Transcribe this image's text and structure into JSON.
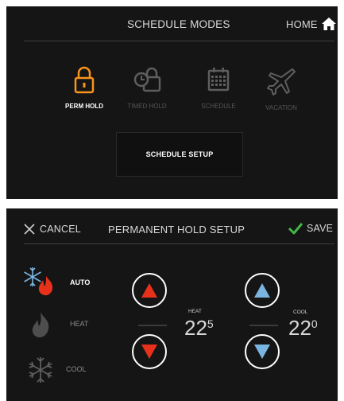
{
  "schedule_modes": {
    "title": "SCHEDULE MODES",
    "home_label": "HOME",
    "modes": [
      {
        "label": "PERM HOLD",
        "icon": "padlock-icon",
        "active": true
      },
      {
        "label": "TIMED HOLD",
        "icon": "timed-lock-icon",
        "active": false
      },
      {
        "label": "SCHEDULE",
        "icon": "calendar-icon",
        "active": false
      },
      {
        "label": "VACATION",
        "icon": "airplane-icon",
        "active": false
      }
    ],
    "setup_button": "SCHEDULE SETUP"
  },
  "hold_setup": {
    "cancel_label": "CANCEL",
    "title": "PERMANENT HOLD SETUP",
    "save_label": "SAVE",
    "modes": [
      {
        "label": "AUTO",
        "icon": "auto-mode-icon",
        "active": true
      },
      {
        "label": "HEAT",
        "icon": "flame-icon",
        "active": false
      },
      {
        "label": "COOL",
        "icon": "snowflake-icon",
        "active": false
      }
    ],
    "heat": {
      "label": "HEAT",
      "value": "22",
      "decimal": "5"
    },
    "cool": {
      "label": "COOL",
      "value": "22",
      "decimal": "0"
    }
  },
  "colors": {
    "background": "#151515",
    "accent_orange": "#f7941d",
    "heat_red": "#e8311b",
    "cool_blue": "#7ab4e0",
    "save_green": "#43b649",
    "inactive_gray": "#5e5e5e"
  }
}
